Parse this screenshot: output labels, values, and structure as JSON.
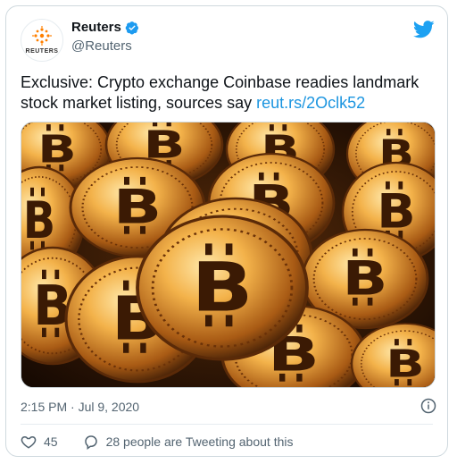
{
  "account": {
    "name": "Reuters",
    "handle": "@Reuters",
    "avatar_text": "REUTERS"
  },
  "tweet": {
    "text": "Exclusive: Crypto exchange Coinbase readies landmark stock market listing, sources say ",
    "link": "reut.rs/2Oclk52",
    "image_alt": "Bitcoin coins",
    "timestamp": "2:15 PM · Jul 9, 2020"
  },
  "engagement": {
    "likes": "45",
    "conversation": "28 people are Tweeting about this"
  },
  "colors": {
    "link": "#1b95e0",
    "verified": "#1d9bf0",
    "bird": "#1da1f2"
  }
}
